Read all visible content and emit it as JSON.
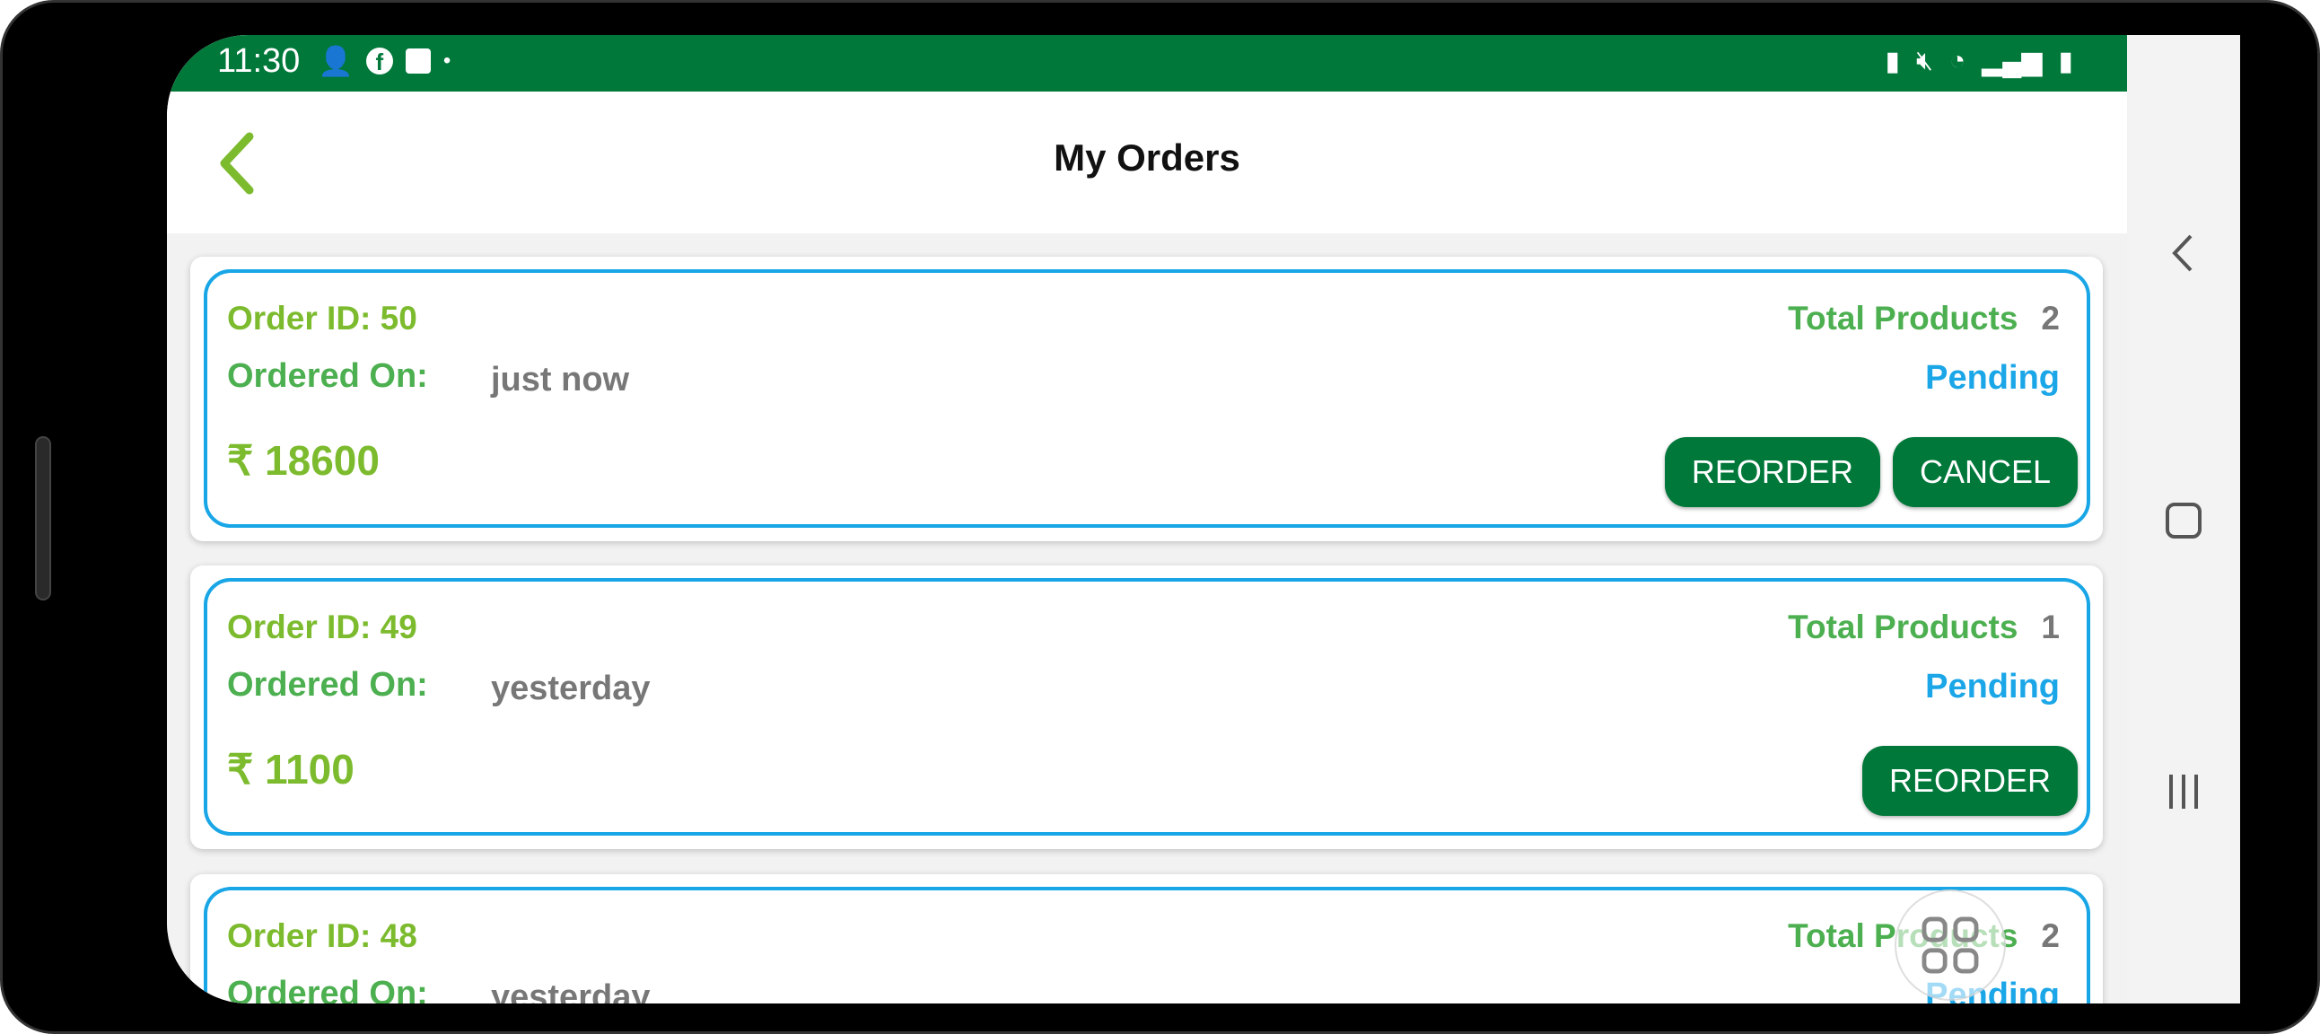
{
  "status_bar": {
    "time": "11:30",
    "left_icons": [
      "person-add-icon",
      "facebook-icon",
      "shopping-bag-icon",
      "dot-icon"
    ],
    "right_icons": [
      "battery-saver-icon",
      "mute-icon",
      "wifi-icon",
      "signal-icon",
      "battery-charging-icon"
    ]
  },
  "header": {
    "title": "My Orders",
    "back_icon": "chevron-left-icon"
  },
  "labels": {
    "order_id_prefix": "Order ID: ",
    "ordered_on": "Ordered On:",
    "total_products": "Total Products",
    "reorder": "REORDER",
    "cancel": "CANCEL"
  },
  "orders": [
    {
      "order_id": "Order ID: 50",
      "ordered_on": "just now",
      "total_products": "2",
      "status": "Pending",
      "price": "₹ 18600",
      "actions": [
        "REORDER",
        "CANCEL"
      ]
    },
    {
      "order_id": "Order ID: 49",
      "ordered_on": "yesterday",
      "total_products": "1",
      "status": "Pending",
      "price": "₹ 1100",
      "actions": [
        "REORDER"
      ]
    },
    {
      "order_id": "Order ID: 48",
      "ordered_on": "yesterday",
      "total_products": "2",
      "status": "Pending"
    }
  ],
  "colors": {
    "status_bar": "#00783a",
    "button": "#00783a",
    "card_border": "#18a6e6",
    "order_id": "#7cbb2e",
    "label": "#4caf50",
    "status": "#1ba6e8"
  }
}
